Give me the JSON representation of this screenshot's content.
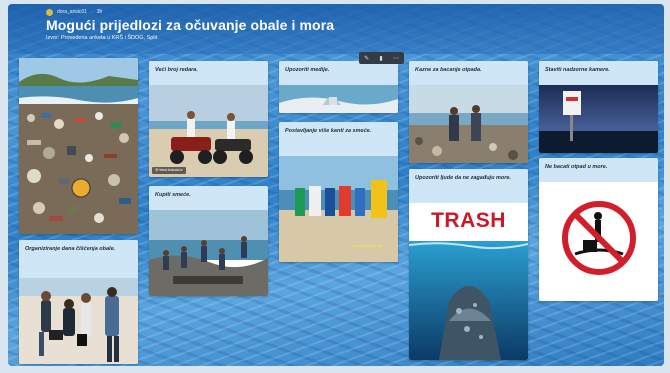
{
  "header": {
    "author": "dora_ansic01",
    "time": "3h",
    "title": "Mogući prijedlozi za očuvanje obale i mora",
    "subtitle": "Izvor: Provedena anketa u KRŠ i ŠDOG, Split"
  },
  "toolbar": {
    "edit_icon": "pencil-icon",
    "trash_icon": "trash-icon",
    "more_icon": "more-icon"
  },
  "cards": {
    "photo_beach_litter": {
      "title": ""
    },
    "organize_cleanup": {
      "title": "Organiziranje dana čišćenja obale."
    },
    "more_guards": {
      "title": "Veći broj redara.",
      "credit": "Ⓜ tekst.trokuta.hr"
    },
    "buy_nets": {
      "title": "Kupiti smeće."
    },
    "warn_media": {
      "title": "Upozoriti medije."
    },
    "more_bins": {
      "title": "Postavljanje više kanti za smeće.",
      "overlay": "Reciklirati & bit"
    },
    "fines": {
      "title": "Kazne za bacanje otpada."
    },
    "warn_people": {
      "title": "Upozoriti ljude da ne zagađuju more.",
      "image_word": "TRASH"
    },
    "cameras": {
      "title": "Staviti nadzorne kamere."
    },
    "no_dumping": {
      "title": "Ne bacati otpad u more."
    }
  }
}
